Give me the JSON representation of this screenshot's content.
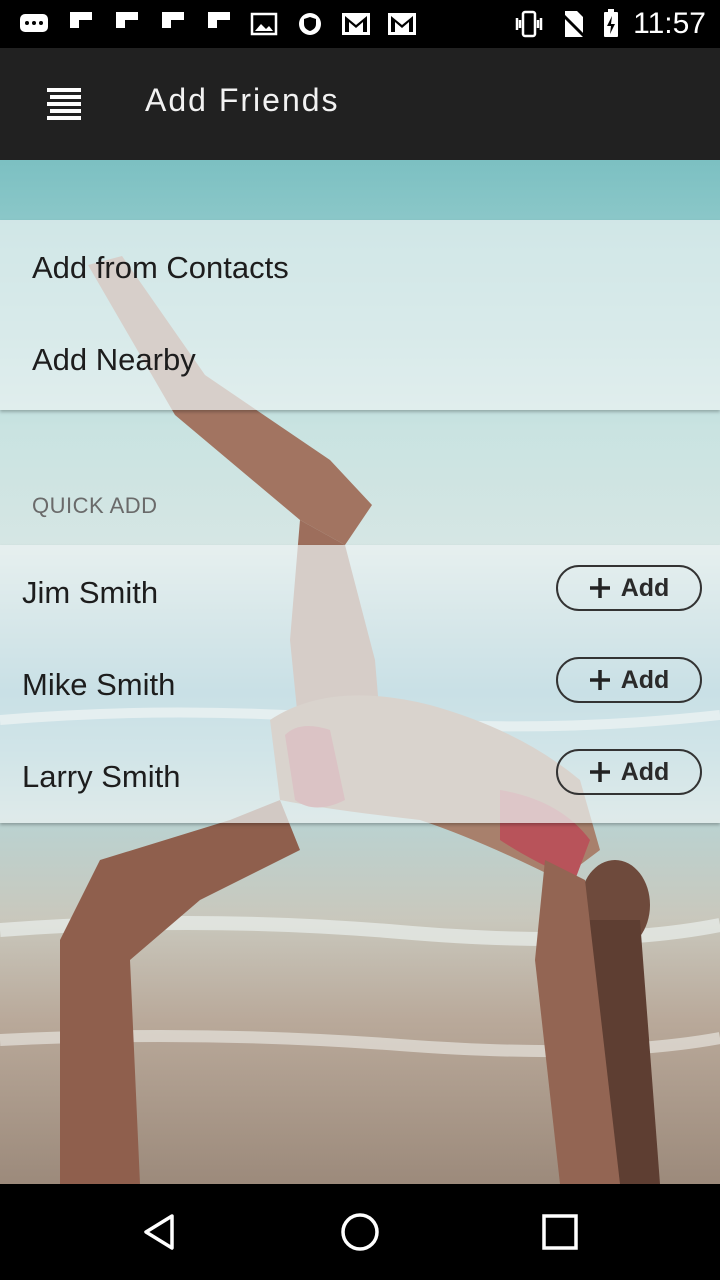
{
  "status_bar": {
    "time": "11:57",
    "left_icons": [
      "chat-bubble-icon",
      "flipboard-icon",
      "flipboard-icon",
      "flipboard-icon",
      "flipboard-icon",
      "image-icon",
      "shield-icon",
      "gmail-icon",
      "gmail-icon"
    ],
    "right_icons": [
      "vibrate-icon",
      "no-sim-icon",
      "battery-charging-icon"
    ]
  },
  "app_bar": {
    "title": "Add Friends",
    "menu_icon": "menu-icon",
    "color": "#212121"
  },
  "options": [
    {
      "label": "Add from Contacts"
    },
    {
      "label": "Add Nearby"
    }
  ],
  "quick_add": {
    "section_label": "QUICK ADD",
    "people": [
      {
        "name": "Jim Smith",
        "button": "Add"
      },
      {
        "name": "Mike Smith",
        "button": "Add"
      },
      {
        "name": "Larry Smith",
        "button": "Add"
      }
    ]
  },
  "nav_bar": {
    "buttons": [
      "back-icon",
      "home-icon",
      "recents-icon"
    ]
  }
}
